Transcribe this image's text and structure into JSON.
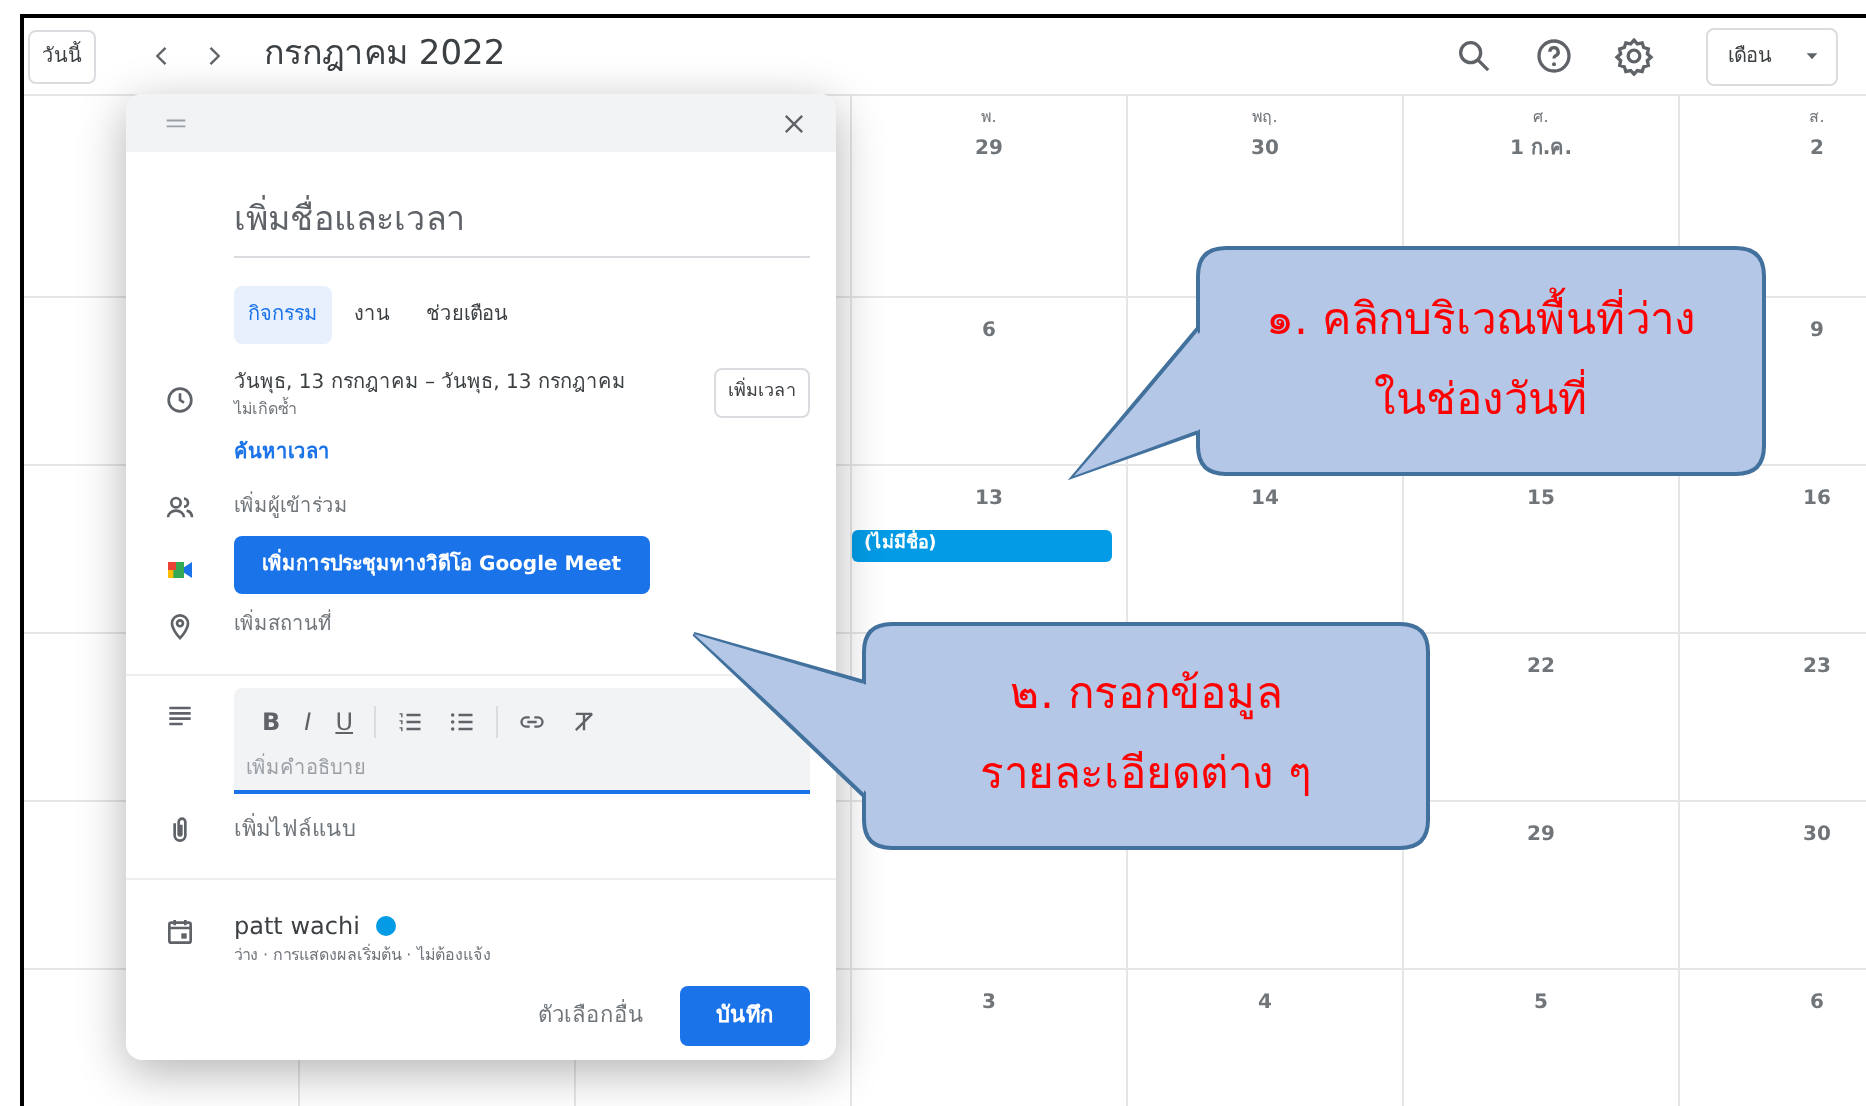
{
  "toolbar": {
    "today_button": "วันนี้",
    "title": "กรกฎาคม 2022",
    "view_button": "เดือน"
  },
  "calendar": {
    "weeks": [
      {
        "cells": [
          null,
          null,
          null,
          {
            "weekday": "พ.",
            "date": "29"
          },
          {
            "weekday": "พฤ.",
            "date": "30"
          },
          {
            "weekday": "ศ.",
            "date": "1 ก.ค."
          },
          {
            "weekday": "ส.",
            "date": "2"
          }
        ]
      },
      {
        "cells": [
          null,
          null,
          null,
          {
            "date": "6"
          },
          null,
          null,
          {
            "date": "9"
          }
        ]
      },
      {
        "cells": [
          null,
          null,
          null,
          {
            "date": "13",
            "events": [
              {
                "title": "(ไม่มีชื่อ)",
                "color": "#039be5"
              }
            ]
          },
          {
            "date": "14"
          },
          {
            "date": "15"
          },
          {
            "date": "16"
          }
        ]
      },
      {
        "cells": [
          null,
          null,
          null,
          null,
          null,
          {
            "date": "22"
          },
          {
            "date": "23"
          }
        ]
      },
      {
        "cells": [
          null,
          null,
          null,
          null,
          null,
          {
            "date": "29"
          },
          {
            "date": "30"
          }
        ]
      },
      {
        "cells": [
          null,
          null,
          null,
          {
            "date": "3"
          },
          {
            "date": "4"
          },
          {
            "date": "5"
          },
          {
            "date": "6"
          }
        ]
      }
    ]
  },
  "dialog": {
    "title_placeholder": "เพิ่มชื่อและเวลา",
    "tabs": [
      {
        "label": "กิจกรรม",
        "selected": true
      },
      {
        "label": "งาน",
        "selected": false
      },
      {
        "label": "ช่วยเตือน",
        "selected": false
      }
    ],
    "date_range": "วันพุธ, 13 กรกฎาคม  –  วันพุธ, 13 กรกฎาคม",
    "recurrence": "ไม่เกิดซ้ำ",
    "add_time_button": "เพิ่มเวลา",
    "find_time_link": "ค้นหาเวลา",
    "guests_placeholder": "เพิ่มผู้เข้าร่วม",
    "meet_button": "เพิ่มการประชุมทางวิดีโอ Google Meet",
    "location_placeholder": "เพิ่มสถานที่",
    "format_buttons": [
      "B",
      "I",
      "U"
    ],
    "description_placeholder": "เพิ่มคำอธิบาย",
    "attachment_label": "เพิ่มไฟล์แนบ",
    "calendar_owner": {
      "name": "patt wachi",
      "color": "#039be5"
    },
    "calendar_details": "ว่าง · การแสดงผลเริ่มต้น · ไม่ต้องแจ้ง",
    "more_options_button": "ตัวเลือกอื่น",
    "save_button": "บันทึก"
  },
  "callouts": [
    {
      "lines": [
        "๑. คลิกบริเวณพื้นที่ว่าง",
        "ในช่องวันที่"
      ]
    },
    {
      "lines": [
        "๒. กรอกข้อมูล",
        "รายละเอียดต่าง ๆ"
      ]
    }
  ]
}
